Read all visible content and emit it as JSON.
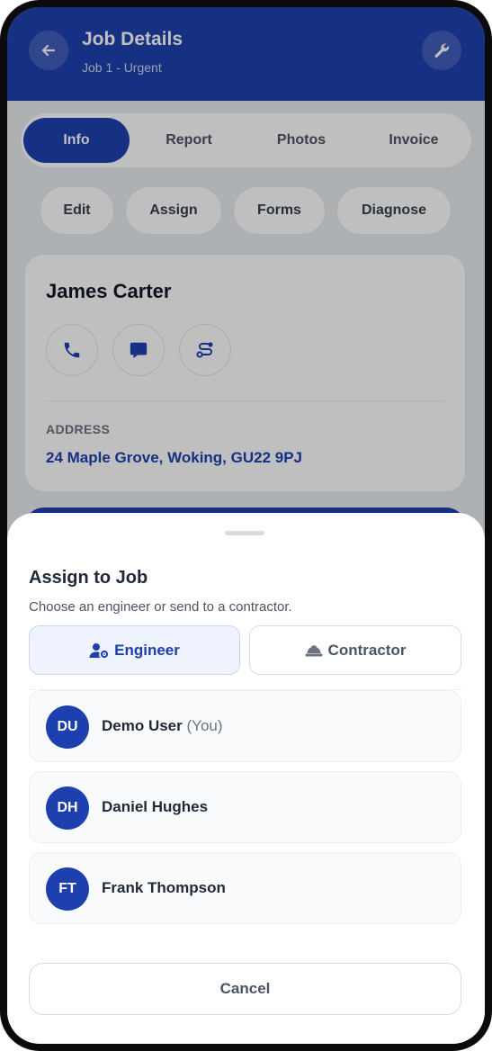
{
  "header": {
    "title": "Job Details",
    "subtitle": "Job 1 - Urgent",
    "back_icon": "arrow-left-icon",
    "tools_icon": "wrench-icon"
  },
  "tabs": [
    {
      "label": "Info",
      "active": true
    },
    {
      "label": "Report",
      "active": false
    },
    {
      "label": "Photos",
      "active": false
    },
    {
      "label": "Invoice",
      "active": false
    }
  ],
  "actions": [
    "Edit",
    "Assign",
    "Forms",
    "Diagnose"
  ],
  "customer": {
    "name": "James Carter",
    "contact_icons": [
      "phone-icon",
      "message-icon",
      "route-icon"
    ],
    "address_label": "ADDRESS",
    "address": "24 Maple Grove, Woking, GU22 9PJ"
  },
  "assign_sheet": {
    "title": "Assign to Job",
    "subtitle": "Choose an engineer or send to a contractor.",
    "segments": [
      {
        "label": "Engineer",
        "icon": "user-gear-icon",
        "selected": true
      },
      {
        "label": "Contractor",
        "icon": "hard-hat-icon",
        "selected": false
      }
    ],
    "engineers": [
      {
        "initials": "DU",
        "name": "Demo User",
        "suffix": "(You)"
      },
      {
        "initials": "DH",
        "name": "Daniel Hughes",
        "suffix": ""
      },
      {
        "initials": "FT",
        "name": "Frank Thompson",
        "suffix": ""
      }
    ],
    "cancel_label": "Cancel"
  },
  "colors": {
    "primary": "#1e40af",
    "background": "#e9ecf1",
    "selected_segment": "#eef3fd"
  }
}
